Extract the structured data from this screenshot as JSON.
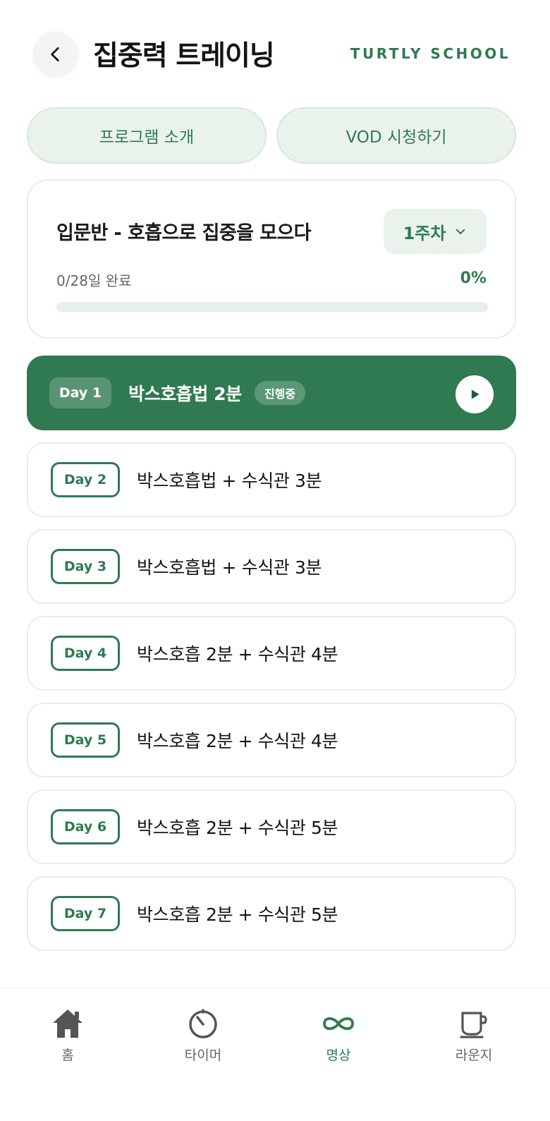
{
  "header": {
    "title": "집중력 트레이닝",
    "brand": "TURTLY SCHOOL"
  },
  "tabs": [
    {
      "label": "프로그램 소개"
    },
    {
      "label": "VOD 시청하기"
    }
  ],
  "program": {
    "title": "입문반 - 호흡으로 집중을 모으다",
    "week_selector": "1주차",
    "progress_text": "0/28일 완료",
    "progress_percent_label": "0%",
    "progress_fraction": 0
  },
  "days": [
    {
      "day": "Day 1",
      "title": "박스호흡법 2분",
      "status": "진행중",
      "active": true
    },
    {
      "day": "Day 2",
      "title": "박스호흡법 + 수식관 3분"
    },
    {
      "day": "Day 3",
      "title": "박스호흡법 + 수식관 3분"
    },
    {
      "day": "Day 4",
      "title": "박스호흡 2분 + 수식관 4분"
    },
    {
      "day": "Day 5",
      "title": "박스호흡 2분 + 수식관 4분"
    },
    {
      "day": "Day 6",
      "title": "박스호흡 2분 + 수식관 5분"
    },
    {
      "day": "Day 7",
      "title": "박스호흡 2분 + 수식관 5분"
    }
  ],
  "bottom_nav": [
    {
      "label": "홈",
      "icon": "home-icon"
    },
    {
      "label": "타이머",
      "icon": "timer-icon"
    },
    {
      "label": "명상",
      "icon": "infinity-icon",
      "active": true
    },
    {
      "label": "라운지",
      "icon": "cup-icon"
    }
  ],
  "colors": {
    "accent": "#2f7a50",
    "accent_light": "#e9f3ec"
  }
}
